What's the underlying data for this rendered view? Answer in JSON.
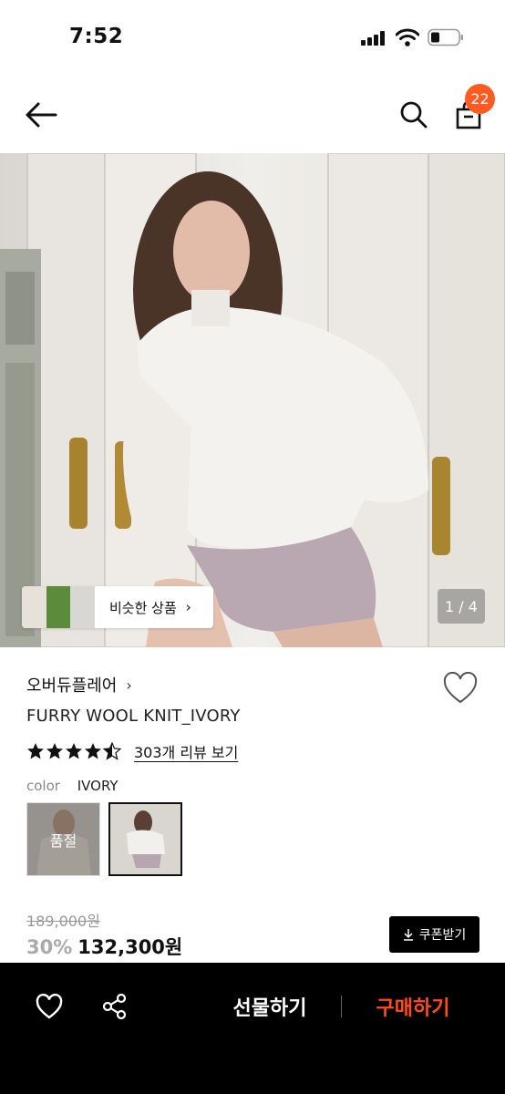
{
  "status_bar": {
    "time": "7:52"
  },
  "header": {
    "cart_count": "22",
    "icons": [
      "back-arrow-icon",
      "search-icon",
      "shopping-bag-icon"
    ]
  },
  "gallery": {
    "page_indicator": "1 / 4",
    "similar_label": "비슷한 상품"
  },
  "product": {
    "brand": "오버듀플레어",
    "name": "FURRY WOOL KNIT_IVORY",
    "rating": 4.5,
    "review_link": "303개 리뷰 보기",
    "color_label": "color",
    "color_value": "IVORY",
    "soldout_label": "품절",
    "original_price": "189,000원",
    "discount": "30%",
    "sale_price": "132,300원",
    "coupon_label": "쿠폰받기"
  },
  "bottom_bar": {
    "gift_label": "선물하기",
    "buy_label": "구매하기"
  },
  "colors": {
    "accent": "#ff5a1f",
    "buy": "#ff4a1c",
    "bottom_bar": "#000000"
  }
}
